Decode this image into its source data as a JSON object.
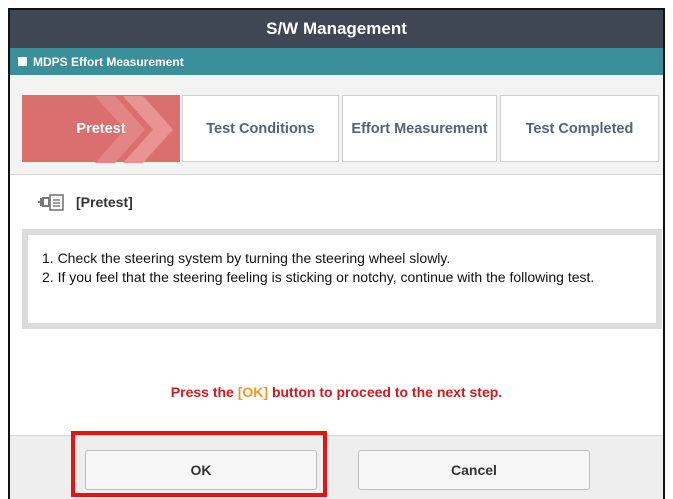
{
  "window": {
    "title": "S/W Management"
  },
  "section": {
    "title": "MDPS Effort Measurement"
  },
  "steps": [
    {
      "label": "Pretest",
      "active": true
    },
    {
      "label": "Test Conditions",
      "active": false
    },
    {
      "label": "Effort Measurement",
      "active": false
    },
    {
      "label": "Test Completed",
      "active": false
    }
  ],
  "content": {
    "heading": "[Pretest]",
    "heading_icon": "scan-tool-icon",
    "line1": "1. Check the steering system by turning the steering wheel slowly.",
    "line2": "2. If you feel that the steering feeling is sticking or notchy, continue with the following test."
  },
  "prompt": {
    "before": "Press the ",
    "ok_label": "[OK]",
    "after": " button to proceed to the next step."
  },
  "buttons": {
    "ok": "OK",
    "cancel": "Cancel"
  },
  "colors": {
    "titlebar": "#3f4654",
    "subbar": "#3a8f9b",
    "active_step": "#d9706f",
    "prompt_text": "#d11b1b",
    "prompt_ok": "#f29a1e",
    "highlight": "#e31414"
  }
}
